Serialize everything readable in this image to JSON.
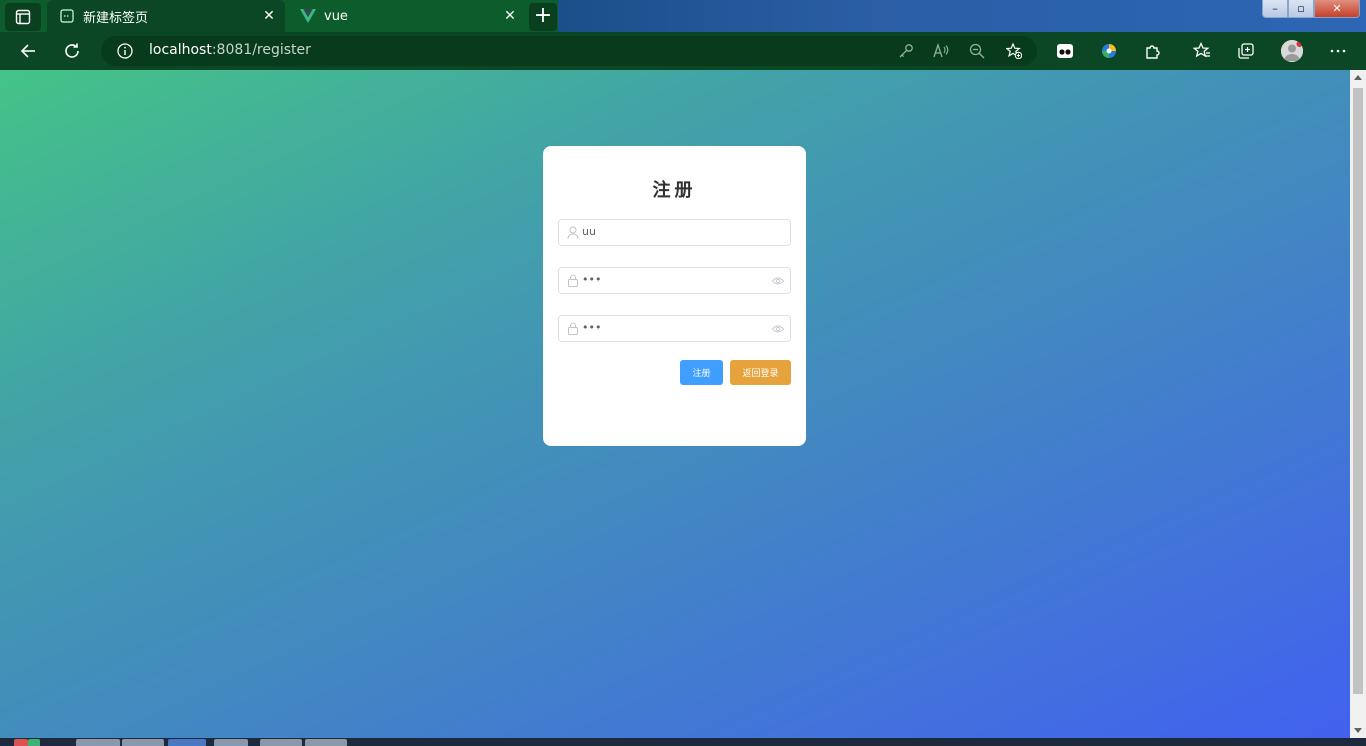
{
  "browser": {
    "tabs": [
      {
        "title": "新建标签页",
        "icon": "new-tab-page-icon"
      },
      {
        "title": "vue",
        "icon": "vue-logo-icon"
      }
    ],
    "new_tab_label": "+",
    "address": {
      "host": "localhost",
      "rest": ":8081/register"
    },
    "window_controls": {
      "minimize": "–",
      "maximize": "▫",
      "close": "✕"
    },
    "accent_color": "#0b4724"
  },
  "register_form": {
    "title": "注册",
    "username": {
      "value": "uu",
      "icon": "user-icon"
    },
    "password": {
      "value": "•••",
      "icon": "lock-icon",
      "toggle_icon": "eye-icon"
    },
    "confirm_password": {
      "value": "•••",
      "icon": "lock-icon",
      "toggle_icon": "eye-icon"
    },
    "register_button": "注册",
    "back_to_login_button": "返回登录",
    "colors": {
      "primary": "#409eff",
      "warning": "#e6a23c"
    }
  }
}
